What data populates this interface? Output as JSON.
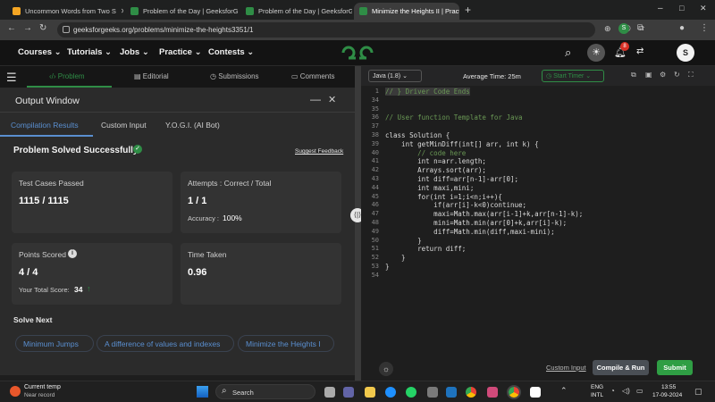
{
  "browser": {
    "tabs": [
      {
        "title": "Uncommon Words from Two S",
        "color": "#f5a623"
      },
      {
        "title": "Problem of the Day | GeeksforG",
        "color": "#2f8d46"
      },
      {
        "title": "Problem of the Day | GeeksforG",
        "color": "#2f8d46"
      },
      {
        "title": "Minimize the Heights II | Practic",
        "color": "#2f8d46"
      }
    ],
    "new_tab": "+",
    "url": "geeksforgeeks.org/problems/minimize-the-heights3351/1",
    "profile_initial": "S",
    "window_controls": [
      "–",
      "□",
      "✕"
    ]
  },
  "site_nav": {
    "items": [
      "Courses",
      "Tutorials",
      "Jobs",
      "Practice",
      "Contests"
    ],
    "logo": "GfG",
    "notification_count": "8",
    "avatar": "S"
  },
  "problem_tabs": [
    "Problem",
    "Editorial",
    "Submissions",
    "Comments"
  ],
  "output": {
    "window_title": "Output Window",
    "tabs": [
      "Compilation Results",
      "Custom Input",
      "Y.O.G.I. (AI Bot)"
    ],
    "status": "Problem Solved Successfully",
    "suggest_feedback": "Suggest Feedback",
    "test_cases_label": "Test Cases Passed",
    "test_cases_value": "1115 / 1115",
    "attempts_label": "Attempts : Correct / Total",
    "attempts_value": "1 / 1",
    "accuracy_label": "Accuracy :",
    "accuracy_value": "100%",
    "points_label": "Points Scored",
    "points_value": "4 / 4",
    "total_score_label": "Your Total Score:",
    "total_score_value": "34",
    "time_label": "Time Taken",
    "time_value": "0.96",
    "solve_next_label": "Solve Next",
    "solve_next": [
      "Minimum Jumps",
      "A difference of values and indexes",
      "Minimize the Heights I"
    ]
  },
  "editor": {
    "language": "Java (1.8)",
    "average_time": "Average Time: 25m",
    "start_timer": "Start Timer",
    "lines": [
      {
        "n": "1",
        "text": "// } Driver Code Ends"
      },
      {
        "n": "34",
        "text": ""
      },
      {
        "n": "35",
        "text": ""
      },
      {
        "n": "36",
        "text": "// User function Template for Java"
      },
      {
        "n": "37",
        "text": ""
      },
      {
        "n": "38",
        "text": "class Solution {"
      },
      {
        "n": "39",
        "text": "    int getMinDiff(int[] arr, int k) {"
      },
      {
        "n": "40",
        "text": "        // code here"
      },
      {
        "n": "41",
        "text": "        int n=arr.length;"
      },
      {
        "n": "42",
        "text": "        Arrays.sort(arr);"
      },
      {
        "n": "43",
        "text": "        int diff=arr[n-1]-arr[0];"
      },
      {
        "n": "44",
        "text": "        int maxi,mini;"
      },
      {
        "n": "45",
        "text": "        for(int i=1;i<n;i++){"
      },
      {
        "n": "46",
        "text": "            if(arr[i]-k<0)continue;"
      },
      {
        "n": "47",
        "text": "            maxi=Math.max(arr[i-1]+k,arr[n-1]-k);"
      },
      {
        "n": "48",
        "text": "            mini=Math.min(arr[0]+k,arr[i]-k);"
      },
      {
        "n": "49",
        "text": "            diff=Math.min(diff,maxi-mini);"
      },
      {
        "n": "50",
        "text": "        }"
      },
      {
        "n": "51",
        "text": "        return diff;"
      },
      {
        "n": "52",
        "text": "    }"
      },
      {
        "n": "53",
        "text": "}"
      },
      {
        "n": "54",
        "text": ""
      }
    ],
    "custom_input": "Custom Input",
    "compile_run": "Compile & Run",
    "submit": "Submit"
  },
  "taskbar": {
    "weather_title": "Current temp",
    "weather_sub": "Near record",
    "search": "Search",
    "lang_top": "ENG",
    "lang_bottom": "INTL",
    "time": "13:55",
    "date": "17-09-2024"
  },
  "colors": {
    "accent_green": "#2f8d46",
    "link_blue": "#5a8fd0",
    "submit_green": "#2f9e44"
  }
}
